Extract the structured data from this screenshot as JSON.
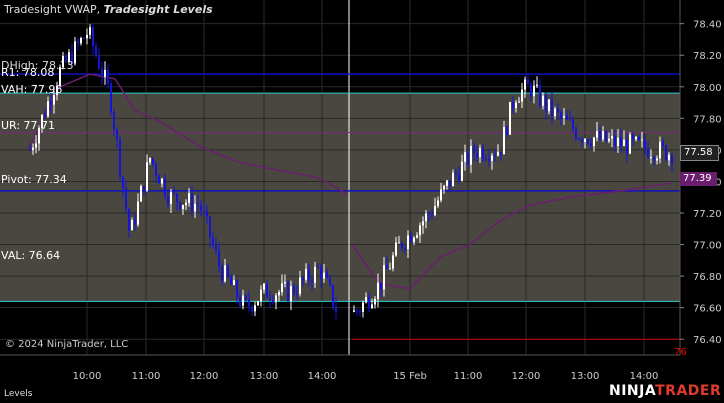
{
  "header": {
    "title": "Tradesight VWAP, ",
    "title_italic": "Tradesight Levels"
  },
  "levels": {
    "r_overlap": "R1: 78.08",
    "r_overlap2": "DHigh: 78.13",
    "vah": "VAH: 77.96",
    "ur": "UR: 77.71",
    "pivot": "Pivot: 77.34",
    "val": "VAL: 76.64",
    "red_tag": "76"
  },
  "price_axis": {
    "ticks": [
      "78.40",
      "78.20",
      "78.00",
      "77.80",
      "77.60",
      "77.40",
      "77.20",
      "77.00",
      "76.80",
      "76.60",
      "76.40"
    ],
    "last_price": "77.58",
    "vwap_price": "77.39"
  },
  "time_axis": {
    "ticks": [
      "10:00",
      "11:00",
      "12:00",
      "13:00",
      "14:00",
      "15 Feb",
      "11:00",
      "12:00",
      "13:00",
      "14:00"
    ]
  },
  "footer": {
    "copyright": "© 2024 NinjaTrader, LLC",
    "tab": "Levels",
    "brand_a": "NINJA",
    "brand_b": "TRADER"
  },
  "colors": {
    "bar_up": "#ffffff",
    "bar_down": "#1515d8",
    "vwap": "#6a1f6e",
    "value_area": "#4a4740",
    "val_line": "#2ad3d3",
    "pivot_line": "#1010c0",
    "ur_line": "#7a2a7a",
    "red_level": "#cc0000"
  },
  "chart_data": {
    "type": "candlestick",
    "ylim": [
      76.3,
      78.55
    ],
    "x": [
      "10:00",
      "10:30",
      "11:00",
      "11:30",
      "12:00",
      "12:30",
      "13:00",
      "13:30",
      "14:00",
      "14:30",
      "15 Feb 10:30",
      "11:00",
      "11:30",
      "12:00",
      "12:30",
      "13:00",
      "13:30",
      "14:00"
    ],
    "close": [
      78.2,
      77.8,
      77.0,
      77.5,
      77.2,
      76.8,
      76.65,
      76.75,
      76.9,
      76.5,
      76.8,
      77.3,
      77.6,
      77.9,
      77.8,
      77.65,
      77.6,
      77.58
    ],
    "levels": {
      "R1": 78.08,
      "VAH": 77.96,
      "UR": 77.71,
      "Pivot": 77.34,
      "VAL": 76.64
    }
  }
}
